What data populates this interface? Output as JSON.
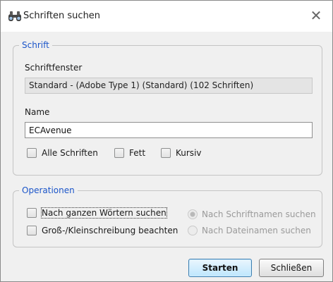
{
  "window": {
    "title": "Schriften suchen",
    "icon": "binoculars-icon",
    "close_glyph": "✕"
  },
  "font_group": {
    "legend": "Schrift",
    "window_label": "Schriftfenster",
    "window_value": "Standard - (Adobe Type 1) (Standard) (102 Schriften)",
    "name_label": "Name",
    "name_value": "ECAvenue",
    "checkboxes": [
      {
        "label": "Alle Schriften",
        "checked": false
      },
      {
        "label": "Fett",
        "checked": false
      },
      {
        "label": "Kursiv",
        "checked": false
      }
    ]
  },
  "ops_group": {
    "legend": "Operationen",
    "checkboxes": [
      {
        "label": "Nach ganzen Wörtern suchen",
        "checked": false,
        "focused": true
      },
      {
        "label": "Groß-/Kleinschreibung beachten",
        "checked": false
      }
    ],
    "radios": [
      {
        "label": "Nach Schriftnamen suchen",
        "selected": true,
        "disabled": true
      },
      {
        "label": "Nach Dateinamen suchen",
        "selected": false,
        "disabled": true
      }
    ]
  },
  "buttons": {
    "start": "Starten",
    "close": "Schließen"
  },
  "colors": {
    "accent": "#1b55c9",
    "primary_button": "#bee6fd",
    "background": "#f0f0f0"
  }
}
